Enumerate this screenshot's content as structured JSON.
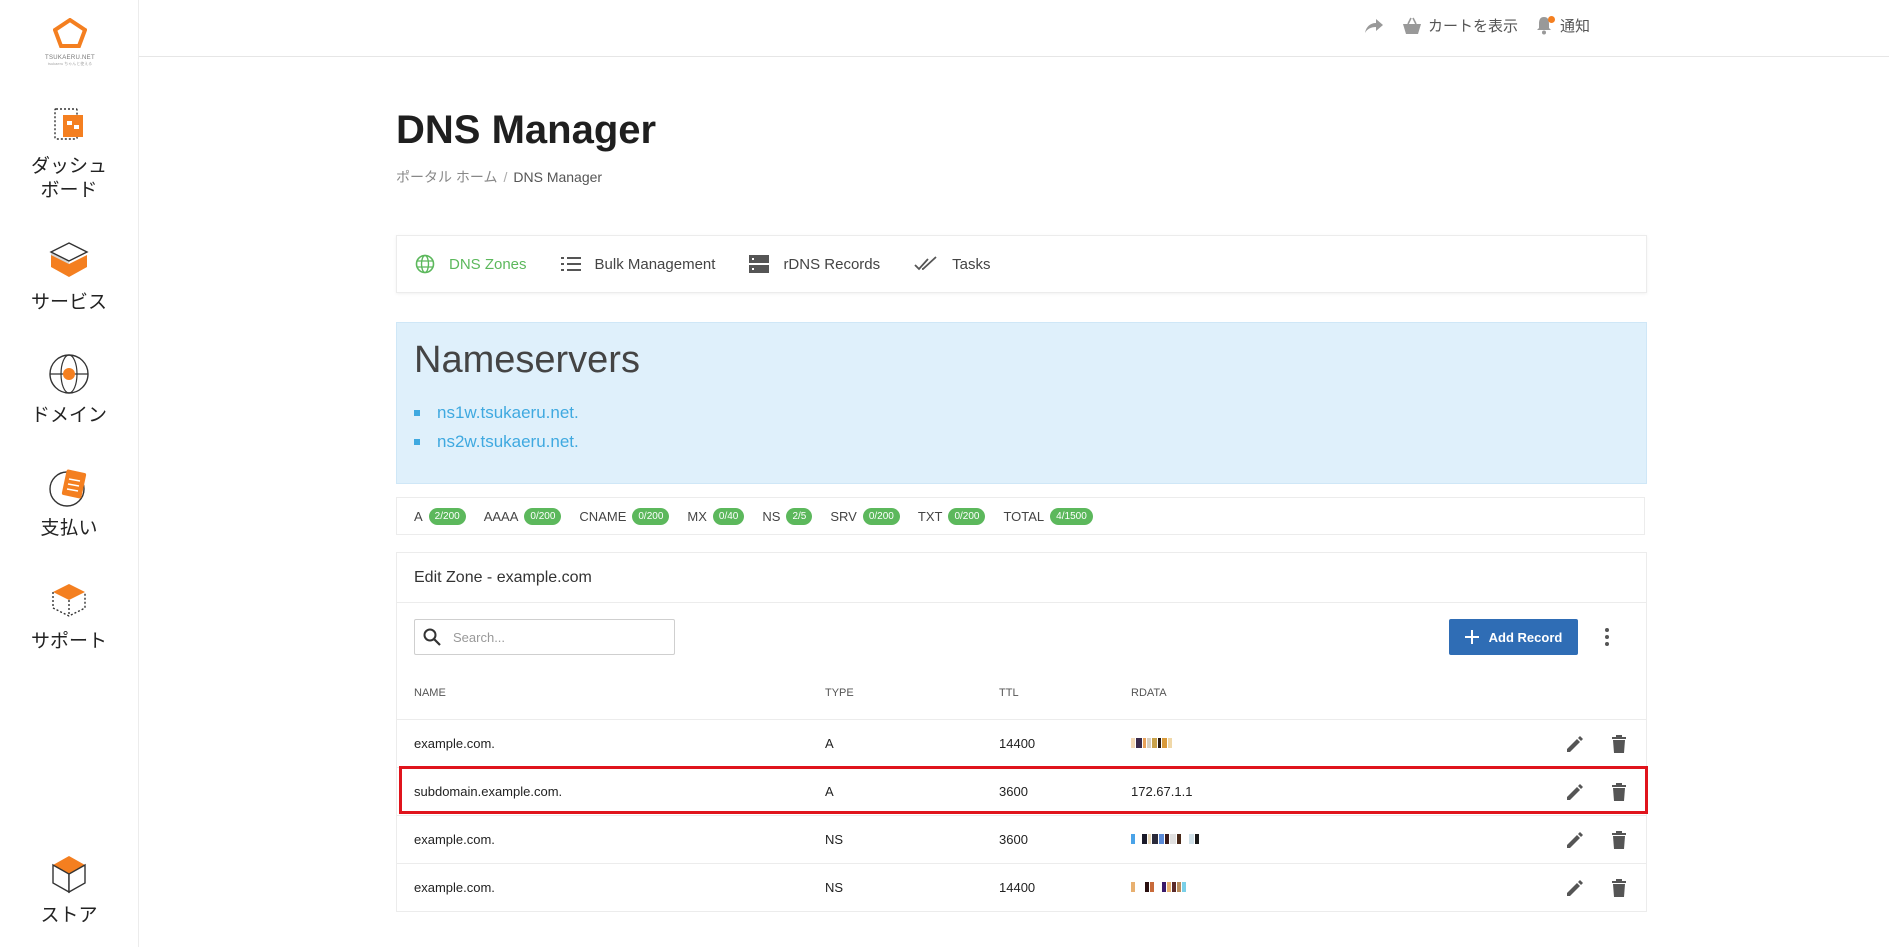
{
  "brand": {
    "logo_text": "TSUKAERU.NET",
    "logo_sub": "tsukaeru ちゃんと使える"
  },
  "sidebar": {
    "items": [
      {
        "label": "ダッシュ\nボード",
        "icon": "dashboard-icon"
      },
      {
        "label": "サービス",
        "icon": "services-icon"
      },
      {
        "label": "ドメイン",
        "icon": "domain-globe-icon"
      },
      {
        "label": "支払い",
        "icon": "payment-icon"
      },
      {
        "label": "サポート",
        "icon": "support-icon"
      },
      {
        "label": "ストア",
        "icon": "store-icon"
      }
    ]
  },
  "topbar": {
    "cart_label": "カートを表示",
    "notifications_label": "通知"
  },
  "page": {
    "title": "DNS Manager",
    "breadcrumb_home": "ポータル ホーム",
    "breadcrumb_separator": "/",
    "breadcrumb_current": "DNS Manager"
  },
  "tabs": [
    {
      "label": "DNS Zones",
      "icon": "globe-icon",
      "active": true
    },
    {
      "label": "Bulk Management",
      "icon": "list-icon",
      "active": false
    },
    {
      "label": "rDNS Records",
      "icon": "server-icon",
      "active": false
    },
    {
      "label": "Tasks",
      "icon": "double-check-icon",
      "active": false
    }
  ],
  "nameservers": {
    "title": "Nameservers",
    "items": [
      "ns1w.tsukaeru.net.",
      "ns2w.tsukaeru.net."
    ]
  },
  "record_counts": [
    {
      "type": "A",
      "count": "2/200"
    },
    {
      "type": "AAAA",
      "count": "0/200"
    },
    {
      "type": "CNAME",
      "count": "0/200"
    },
    {
      "type": "MX",
      "count": "0/40"
    },
    {
      "type": "NS",
      "count": "2/5"
    },
    {
      "type": "SRV",
      "count": "0/200"
    },
    {
      "type": "TXT",
      "count": "0/200"
    },
    {
      "type": "TOTAL",
      "count": "4/1500"
    }
  ],
  "zone": {
    "title": "Edit Zone - example.com",
    "search_placeholder": "Search...",
    "add_record_label": "Add Record",
    "columns": {
      "name": "NAME",
      "type": "TYPE",
      "ttl": "TTL",
      "rdata": "RDATA"
    },
    "rows": [
      {
        "name": "example.com.",
        "type": "A",
        "ttl": "14400",
        "rdata": "",
        "rdata_redacted": true
      },
      {
        "name": "subdomain.example.com.",
        "type": "A",
        "ttl": "3600",
        "rdata": "172.67.1.1",
        "rdata_redacted": false,
        "highlighted": true
      },
      {
        "name": "example.com.",
        "type": "NS",
        "ttl": "3600",
        "rdata": "",
        "rdata_redacted": true
      },
      {
        "name": "example.com.",
        "type": "NS",
        "ttl": "14400",
        "rdata": "",
        "rdata_redacted": true
      }
    ]
  },
  "colors": {
    "accent_green": "#5cb85c",
    "primary_blue": "#2f6db5",
    "brand_orange": "#f47f20",
    "info_bg": "#dff0fb",
    "link_blue": "#3fa9e0",
    "highlight_red": "#e0141c"
  }
}
